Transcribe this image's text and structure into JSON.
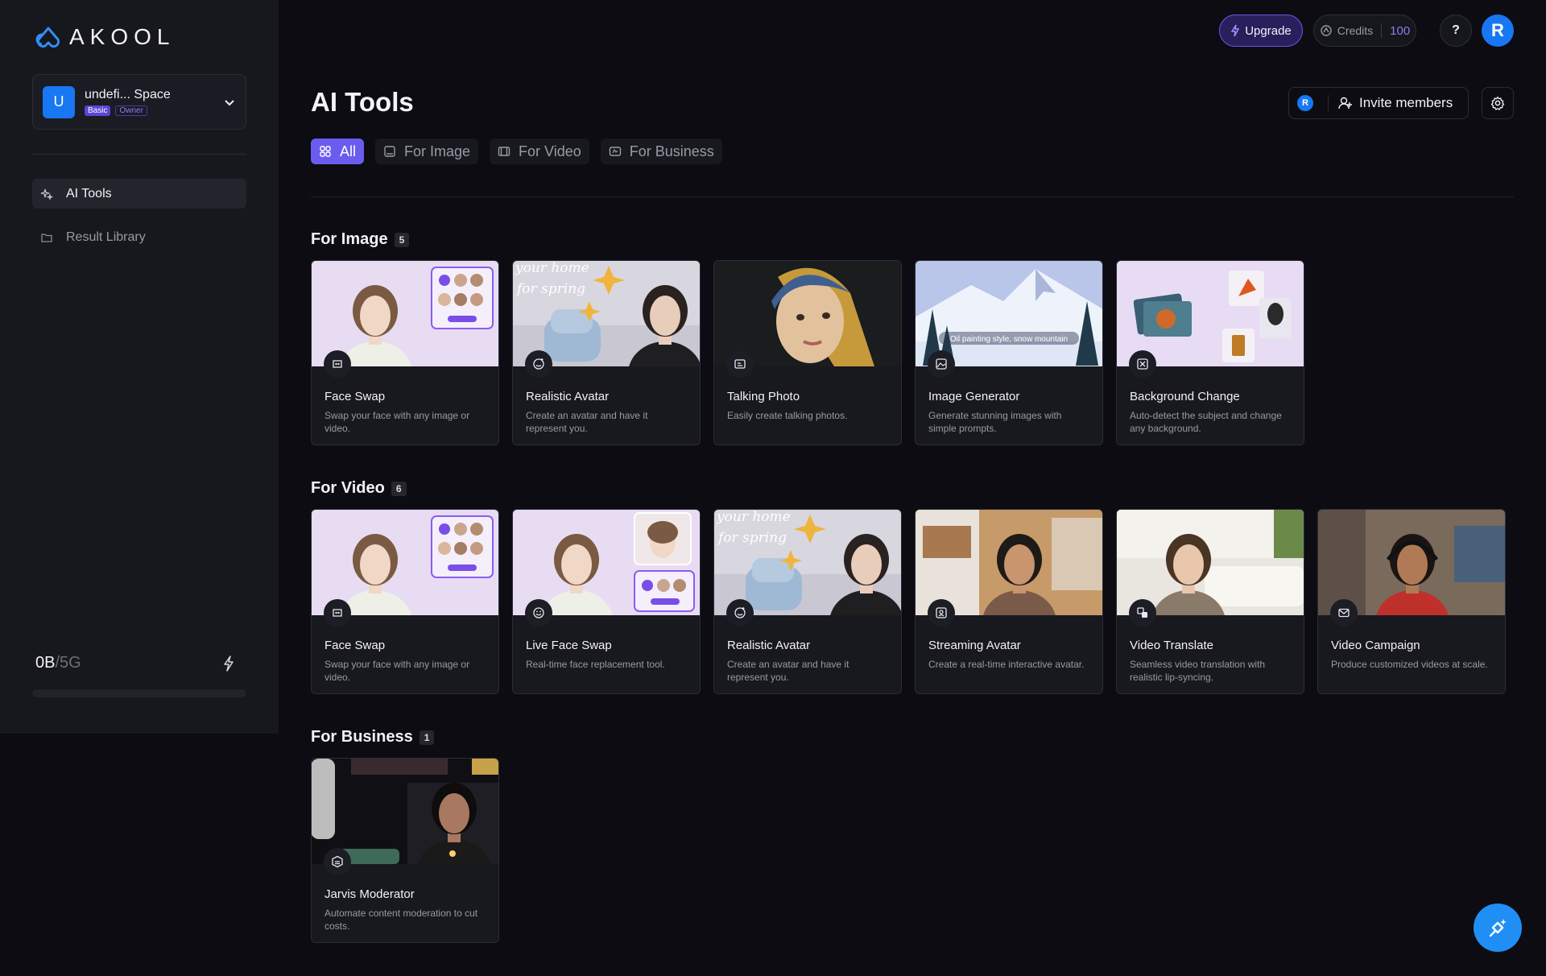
{
  "brand": {
    "logo_text": "AKOOL"
  },
  "space": {
    "avatar_letter": "U",
    "name": "undefi... Space",
    "plan_tag": "Basic",
    "role_tag": "Owner"
  },
  "sidebar": {
    "items": [
      {
        "label": "AI Tools",
        "icon": "sparkle-icon",
        "active": true
      },
      {
        "label": "Result Library",
        "icon": "folder-icon",
        "active": false
      }
    ],
    "storage": {
      "used": "0B",
      "separator": "/",
      "total": "5G",
      "fill": 0
    }
  },
  "topbar": {
    "upgrade_label": "Upgrade",
    "credits_label": "Credits",
    "credits_value": "100",
    "help_label": "?",
    "user_initial": "R"
  },
  "header": {
    "title": "AI Tools",
    "member_initial": "R",
    "invite_label": "Invite members"
  },
  "tabs": [
    {
      "label": "All",
      "icon": "grid-icon",
      "active": true
    },
    {
      "label": "For Image",
      "icon": "image-icon",
      "active": false
    },
    {
      "label": "For Video",
      "icon": "film-icon",
      "active": false
    },
    {
      "label": "For Business",
      "icon": "business-icon",
      "active": false
    }
  ],
  "sections": [
    {
      "title": "For Image",
      "count": "5",
      "cards": [
        {
          "title": "Face Swap",
          "desc": "Swap your face with any image or video.",
          "thumb": "faceswap"
        },
        {
          "title": "Realistic Avatar",
          "desc": "Create an avatar and have it represent you.",
          "thumb": "avatar"
        },
        {
          "title": "Talking Photo",
          "desc": "Easily create talking photos.",
          "thumb": "talking"
        },
        {
          "title": "Image Generator",
          "desc": "Generate stunning images with simple prompts.",
          "thumb": "generator",
          "overlay": "Oil painting style, snow mountain"
        },
        {
          "title": "Background Change",
          "desc": "Auto-detect the subject and change any background.",
          "thumb": "background"
        }
      ]
    },
    {
      "title": "For Video",
      "count": "6",
      "cards": [
        {
          "title": "Face Swap",
          "desc": "Swap your face with any image or video.",
          "thumb": "faceswap"
        },
        {
          "title": "Live Face Swap",
          "desc": "Real-time face replacement tool.",
          "thumb": "liveswap"
        },
        {
          "title": "Realistic Avatar",
          "desc": "Create an avatar and have it represent you.",
          "thumb": "avatar"
        },
        {
          "title": "Streaming Avatar",
          "desc": "Create a real-time interactive avatar.",
          "thumb": "streaming"
        },
        {
          "title": "Video Translate",
          "desc": "Seamless video translation with realistic lip-syncing.",
          "thumb": "translate"
        },
        {
          "title": "Video Campaign",
          "desc": "Produce customized videos at scale.",
          "thumb": "campaign"
        }
      ]
    },
    {
      "title": "For Business",
      "count": "1",
      "cards": [
        {
          "title": "Jarvis Moderator",
          "desc": "Automate content moderation to cut costs.",
          "thumb": "jarvis"
        }
      ]
    }
  ],
  "overlay_texts": {
    "spring_line1": "your home",
    "spring_line2": "for spring"
  },
  "colors": {
    "accent": "#6b5cf0",
    "brand_blue": "#1877f2",
    "background": "#0c0c12",
    "sidebar": "#17171e"
  }
}
